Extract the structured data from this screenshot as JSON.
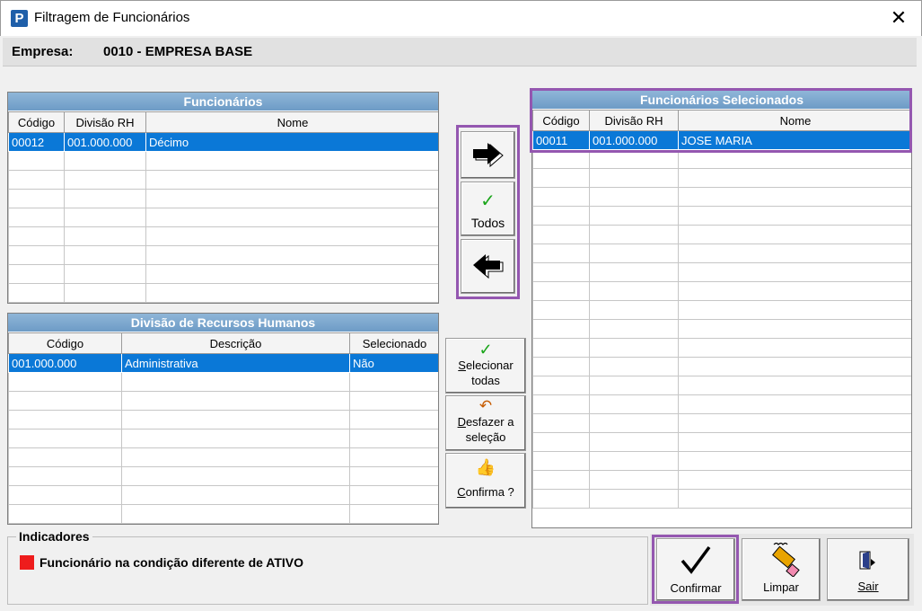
{
  "window": {
    "title": "Filtragem de Funcionários",
    "close_glyph": "✕",
    "app_icon": "P"
  },
  "empresa": {
    "label": "Empresa:",
    "value": "0010 - EMPRESA BASE"
  },
  "funcionarios": {
    "title": "Funcionários",
    "columns": [
      "Código",
      "Divisão RH",
      "Nome"
    ],
    "rows": [
      [
        "00012",
        "001.000.000",
        "Décimo"
      ]
    ]
  },
  "divisao": {
    "title": "Divisão de Recursos Humanos",
    "columns": [
      "Código",
      "Descrição",
      "Selecionado"
    ],
    "rows": [
      [
        "001.000.000",
        "Administrativa",
        "Não"
      ]
    ]
  },
  "selecionados": {
    "title": "Funcionários Selecionados",
    "columns": [
      "Código",
      "Divisão RH",
      "Nome"
    ],
    "rows": [
      [
        "00011",
        "001.000.000",
        "JOSE MARIA"
      ]
    ]
  },
  "transfer_buttons": {
    "add_icon": "arrow-right-icon",
    "todos_label": "Todos",
    "remove_icon": "arrow-left-icon"
  },
  "division_buttons": {
    "select_all": {
      "accel": "S",
      "rest_line1": "elecionar",
      "line2": "todas"
    },
    "undo": {
      "accel": "D",
      "rest_line1": "esfazer a",
      "line2": "seleção"
    },
    "confirm": {
      "accel": "C",
      "rest": "onfirma ?"
    }
  },
  "indicadores": {
    "title": "Indicadores",
    "items": [
      {
        "color": "#ee1c1c",
        "text": "Funcionário na condição diferente de ATIVO"
      }
    ]
  },
  "action_buttons": {
    "confirmar": "Confirmar",
    "limpar": "Limpar",
    "sair": "Sair"
  },
  "colors": {
    "accent_highlight": "#9457b0",
    "selection": "#0a78d7",
    "header_blue": "#6d9bc6"
  }
}
